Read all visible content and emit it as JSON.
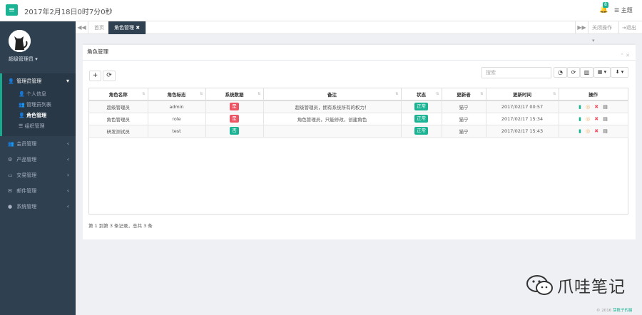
{
  "header": {
    "menu_icon": "≡",
    "clock": "2017年2月18日0时7分0秒",
    "bell_icon": "🔔",
    "notification_count": "8",
    "theme_label": "主题"
  },
  "sidebar": {
    "username": "超级管理员 ▾",
    "menu": [
      {
        "icon": "👤",
        "label": "管理员管理",
        "arrow": "▾"
      },
      {
        "icon": "👥",
        "label": "会员管理",
        "arrow": "‹"
      },
      {
        "icon": "⚙",
        "label": "产品管理",
        "arrow": "‹"
      },
      {
        "icon": "▭",
        "label": "交易管理",
        "arrow": "‹"
      },
      {
        "icon": "✉",
        "label": "邮件管理",
        "arrow": "‹"
      },
      {
        "icon": "●",
        "label": "系统管理",
        "arrow": "‹"
      }
    ],
    "submenu": [
      {
        "icon": "👤",
        "label": "个人信息"
      },
      {
        "icon": "👥",
        "label": "管理员列表"
      },
      {
        "icon": "👤",
        "label": "角色管理"
      },
      {
        "icon": "☰",
        "label": "组织管理"
      }
    ]
  },
  "tabs": {
    "nav_left": "◀◀",
    "items": [
      "首页",
      "角色管理 ✖"
    ],
    "nav_right": "▶▶",
    "close_ops": "关闭操作 ▾",
    "logout": "退出"
  },
  "panel": {
    "title": "角色管理",
    "tools": "⌃ ✕",
    "add_button": "+",
    "refresh_button": "⟳",
    "search_placeholder": "搜索",
    "toolbar_icons": [
      "◔",
      "⟳",
      "▥",
      "▦ ▾",
      "⬇ ▾"
    ]
  },
  "table": {
    "columns": [
      "角色名称",
      "角色标志",
      "系统数据",
      "备注",
      "状态",
      "更新者",
      "更新时间",
      "操作"
    ],
    "rows": [
      {
        "name": "超级管理员",
        "flag": "admin",
        "system": "是",
        "system_color": "red",
        "remark": "超级管理员，拥有系统所有的权力！",
        "status": "正常",
        "updater": "猫宁",
        "time": "2017/02/17 00:57"
      },
      {
        "name": "角色管理员",
        "flag": "role",
        "system": "是",
        "system_color": "red",
        "remark": "角色管理员，只能修改，创建角色",
        "status": "正常",
        "updater": "猫宁",
        "time": "2017/02/17 15:34"
      },
      {
        "name": "研发测试员",
        "flag": "test",
        "system": "否",
        "system_color": "green",
        "remark": "",
        "status": "正常",
        "updater": "猫宁",
        "time": "2017/02/17 15:43"
      }
    ],
    "ops_icons": [
      "▮",
      "◎",
      "✖",
      "▤"
    ]
  },
  "pagination": {
    "info": "第 1 到第 3 条记录，总共 3 条"
  },
  "watermark": {
    "text": "爪哇笔记"
  },
  "footer": {
    "prefix": "© 2016 ",
    "author": "芽靴子的猫"
  },
  "colors": {
    "accent": "#1ab394",
    "sidebar_bg": "#2f4050",
    "danger": "#ed5565"
  }
}
